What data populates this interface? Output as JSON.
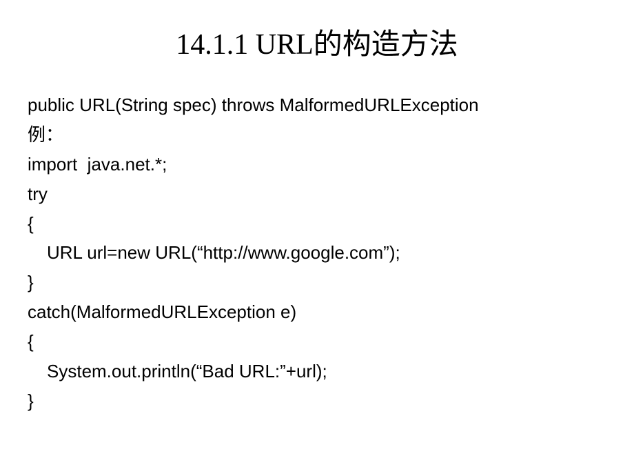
{
  "title": "14.1.1 URL的构造方法",
  "lines": {
    "l1": "public URL(String spec) throws MalformedURLException",
    "l2": "例：",
    "l3": "import  java.net.*;",
    "l4": "try",
    "l5": "{",
    "l6": "URL url=new URL(“http://www.google.com”);",
    "l7": "}",
    "l8": "catch(MalformedURLException e)",
    "l9": "{",
    "l10": "System.out.println(“Bad URL:”+url);",
    "l11": "}"
  }
}
